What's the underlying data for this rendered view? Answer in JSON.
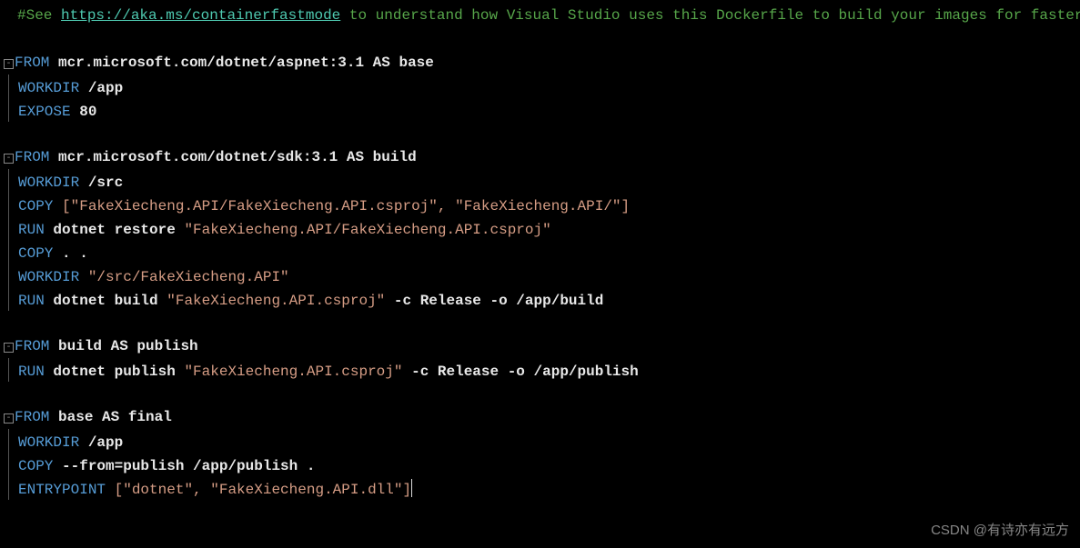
{
  "comment": {
    "prefix": "#See ",
    "link": "https://aka.ms/containerfastmode",
    "suffix": " to understand how Visual Studio uses this Dockerfile to build your images for faster debugging."
  },
  "watermark": "CSDN @有诗亦有远方",
  "lines": [
    {
      "fold": true,
      "tokens": [
        {
          "c": "kw",
          "t": "FROM "
        },
        {
          "c": "white",
          "t": "mcr.microsoft.com/dotnet/aspnet:3.1 AS base"
        }
      ]
    },
    {
      "guide": true,
      "tokens": [
        {
          "c": "kw",
          "t": "WORKDIR "
        },
        {
          "c": "white",
          "t": "/app"
        }
      ]
    },
    {
      "guide": true,
      "tokens": [
        {
          "c": "kw",
          "t": "EXPOSE "
        },
        {
          "c": "white",
          "t": "80"
        }
      ]
    },
    {
      "blank": true
    },
    {
      "fold": true,
      "tokens": [
        {
          "c": "kw",
          "t": "FROM "
        },
        {
          "c": "white",
          "t": "mcr.microsoft.com/dotnet/sdk:3.1 AS build"
        }
      ]
    },
    {
      "guide": true,
      "tokens": [
        {
          "c": "kw",
          "t": "WORKDIR "
        },
        {
          "c": "white",
          "t": "/src"
        }
      ]
    },
    {
      "guide": true,
      "tokens": [
        {
          "c": "kw",
          "t": "COPY "
        },
        {
          "c": "str",
          "t": "[\"FakeXiecheng.API/FakeXiecheng.API.csproj\", \"FakeXiecheng.API/\"]"
        }
      ]
    },
    {
      "guide": true,
      "tokens": [
        {
          "c": "kw",
          "t": "RUN "
        },
        {
          "c": "white",
          "t": "dotnet restore "
        },
        {
          "c": "str",
          "t": "\"FakeXiecheng.API/FakeXiecheng.API.csproj\""
        }
      ]
    },
    {
      "guide": true,
      "tokens": [
        {
          "c": "kw",
          "t": "COPY "
        },
        {
          "c": "white",
          "t": ". ."
        }
      ]
    },
    {
      "guide": true,
      "tokens": [
        {
          "c": "kw",
          "t": "WORKDIR "
        },
        {
          "c": "str",
          "t": "\"/src/FakeXiecheng.API\""
        }
      ]
    },
    {
      "guide": true,
      "tokens": [
        {
          "c": "kw",
          "t": "RUN "
        },
        {
          "c": "white",
          "t": "dotnet build "
        },
        {
          "c": "str",
          "t": "\"FakeXiecheng.API.csproj\""
        },
        {
          "c": "white",
          "t": " -c Release -o /app/build"
        }
      ]
    },
    {
      "blank": true
    },
    {
      "fold": true,
      "tokens": [
        {
          "c": "kw",
          "t": "FROM "
        },
        {
          "c": "white",
          "t": "build AS publish"
        }
      ]
    },
    {
      "guide": true,
      "tokens": [
        {
          "c": "kw",
          "t": "RUN "
        },
        {
          "c": "white",
          "t": "dotnet publish "
        },
        {
          "c": "str",
          "t": "\"FakeXiecheng.API.csproj\""
        },
        {
          "c": "white",
          "t": " -c Release -o /app/publish"
        }
      ]
    },
    {
      "blank": true
    },
    {
      "fold": true,
      "tokens": [
        {
          "c": "kw",
          "t": "FROM "
        },
        {
          "c": "white",
          "t": "base AS final"
        }
      ]
    },
    {
      "guide": true,
      "tokens": [
        {
          "c": "kw",
          "t": "WORKDIR "
        },
        {
          "c": "white",
          "t": "/app"
        }
      ]
    },
    {
      "guide": true,
      "tokens": [
        {
          "c": "kw",
          "t": "COPY "
        },
        {
          "c": "white",
          "t": "--from=publish /app/publish ."
        }
      ]
    },
    {
      "guide": true,
      "cursor": true,
      "tokens": [
        {
          "c": "kw",
          "t": "ENTRYPOINT "
        },
        {
          "c": "str",
          "t": "[\"dotnet\", \"FakeXiecheng.API.dll\"]"
        }
      ]
    }
  ]
}
